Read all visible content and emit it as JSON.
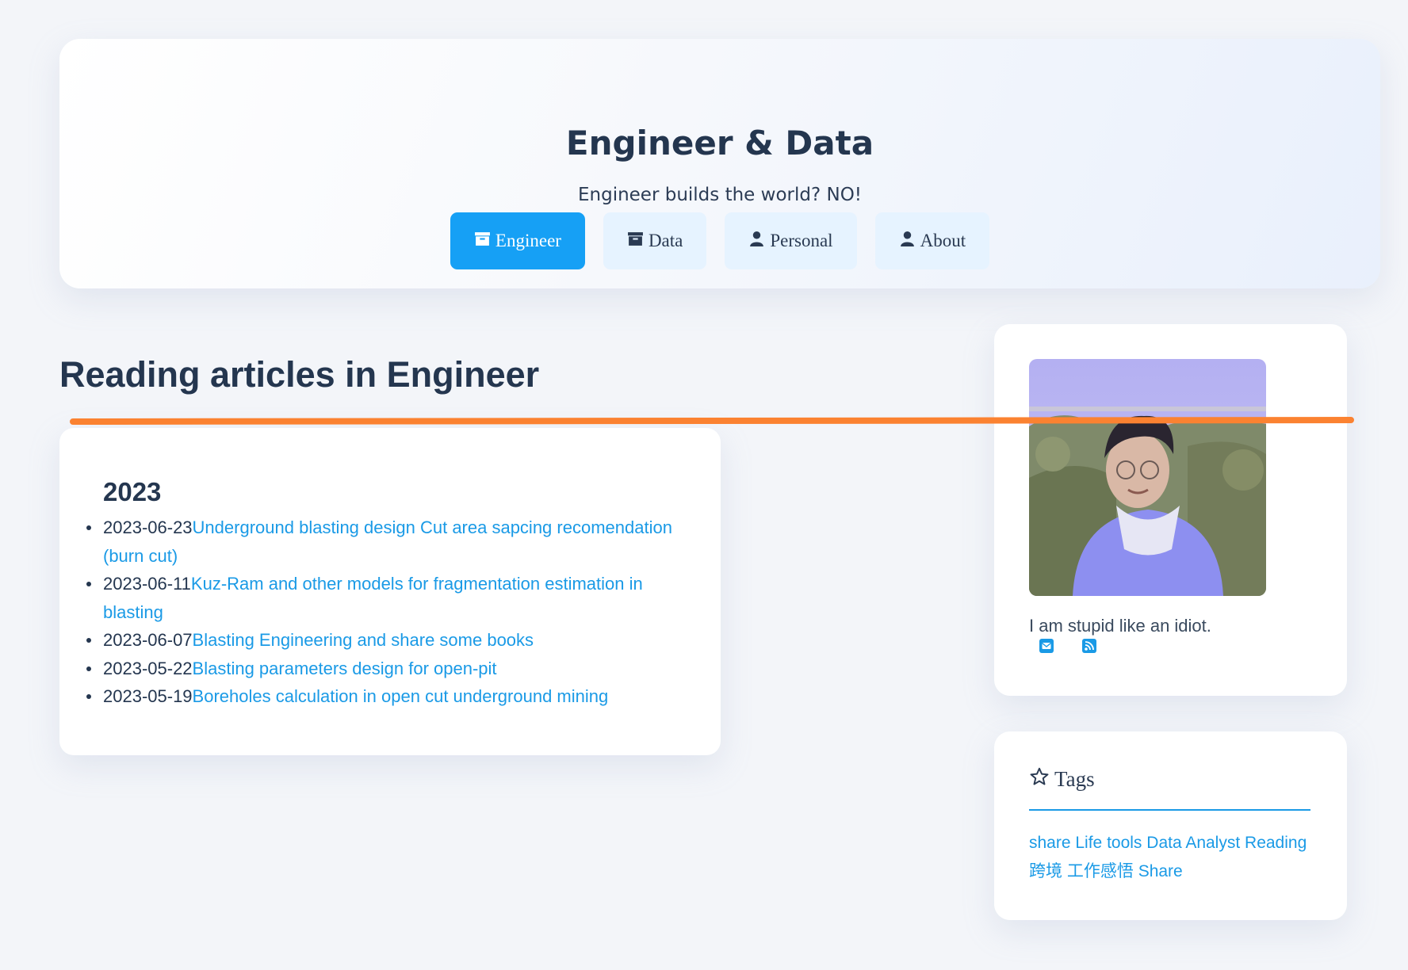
{
  "site": {
    "title": "Engineer & Data",
    "subtitle": "Engineer builds the world? NO!"
  },
  "nav": [
    {
      "label": "Engineer",
      "icon": "archive-icon",
      "active": true
    },
    {
      "label": "Data",
      "icon": "archive-icon",
      "active": false
    },
    {
      "label": "Personal",
      "icon": "user-icon",
      "active": false
    },
    {
      "label": "About",
      "icon": "user-icon",
      "active": false
    }
  ],
  "main": {
    "heading": "Reading articles in Engineer",
    "year": "2023",
    "articles": [
      {
        "date": "2023-06-23",
        "title": "Underground blasting design Cut area sapcing recomendation (burn cut)"
      },
      {
        "date": "2023-06-11",
        "title": "Kuz-Ram and other models for fragmentation estimation in blasting"
      },
      {
        "date": "2023-06-07",
        "title": "Blasting Engineering and share some books"
      },
      {
        "date": "2023-05-22",
        "title": "Blasting parameters design for open-pit"
      },
      {
        "date": "2023-05-19",
        "title": "Boreholes calculation in open cut underground mining"
      }
    ]
  },
  "sidebar": {
    "bio": "I am stupid like an idiot.",
    "social": [
      "envelope-icon",
      "rss-icon"
    ],
    "tags_title": "Tags",
    "tags": [
      "share",
      "Life",
      "tools",
      "Data Analyst",
      "Reading",
      "跨境",
      "工作感悟",
      "Share"
    ]
  },
  "colors": {
    "accent": "#16a0f5",
    "link": "#1a9ae6",
    "text": "#24364f",
    "annotation_line": "#fb8231"
  }
}
